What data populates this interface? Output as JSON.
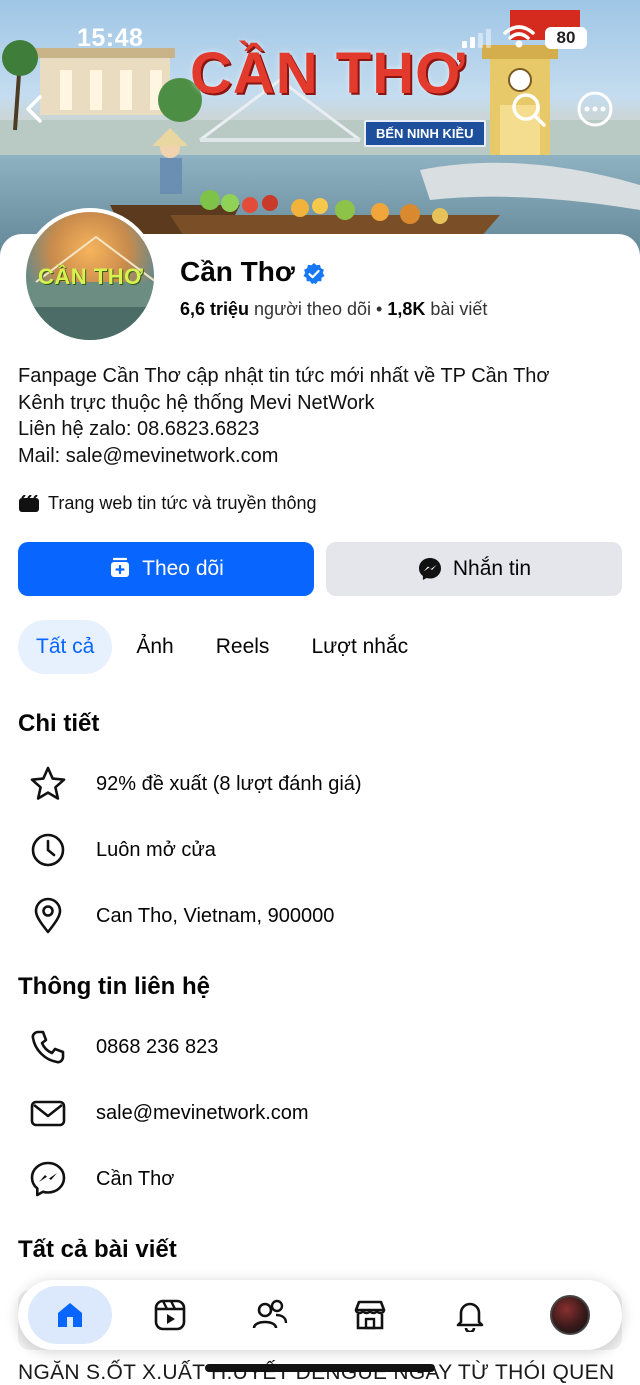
{
  "status_bar": {
    "time": "15:48",
    "battery": "80"
  },
  "cover": {
    "title": "CẦN THƠ",
    "sign": "BẾN NINH KIỀU",
    "avatar_text": "CẦN THƠ"
  },
  "page": {
    "name": "Cần Thơ",
    "followers_count": "6,6 triệu",
    "followers_label": "người theo dõi",
    "separator": "•",
    "posts_count": "1,8K",
    "posts_label": "bài viết"
  },
  "bio": [
    "Fanpage Cần Thơ cập nhật tin tức mới nhất về TP Cần Thơ",
    "Kênh trực thuộc hệ thống Mevi NetWork",
    "Liên hệ zalo: 08.6823.6823",
    "Mail: sale@mevinetwork.com"
  ],
  "category": "Trang web tin tức và truyền thông",
  "actions": {
    "follow": "Theo dõi",
    "message": "Nhắn tin"
  },
  "tabs": [
    {
      "label": "Tất cả",
      "active": true
    },
    {
      "label": "Ảnh",
      "active": false
    },
    {
      "label": "Reels",
      "active": false
    },
    {
      "label": "Lượt nhắc",
      "active": false
    }
  ],
  "details": {
    "title": "Chi tiết",
    "rating": "92% đề xuất (8 lượt đánh giá)",
    "hours": "Luôn mở cửa",
    "location": "Can Tho, Vietnam, 900000"
  },
  "contact": {
    "title": "Thông tin liên hệ",
    "phone": "0868 236 823",
    "email": "sale@mevinetwork.com",
    "messenger": "Cần Thơ"
  },
  "posts": {
    "title": "Tất cả bài viết",
    "headline": "NGĂN S.ỐT X.UẤT H.UYẾT DENGUE NGAY TỪ THÓI QUEN"
  },
  "colors": {
    "accent": "#0866ff",
    "tab_active_bg": "#e7f0fd",
    "button_secondary": "#e4e6eb"
  },
  "icons": {
    "nav": [
      "home-icon",
      "video-icon",
      "friends-icon",
      "marketplace-icon",
      "bell-icon",
      "profile-avatar"
    ]
  }
}
